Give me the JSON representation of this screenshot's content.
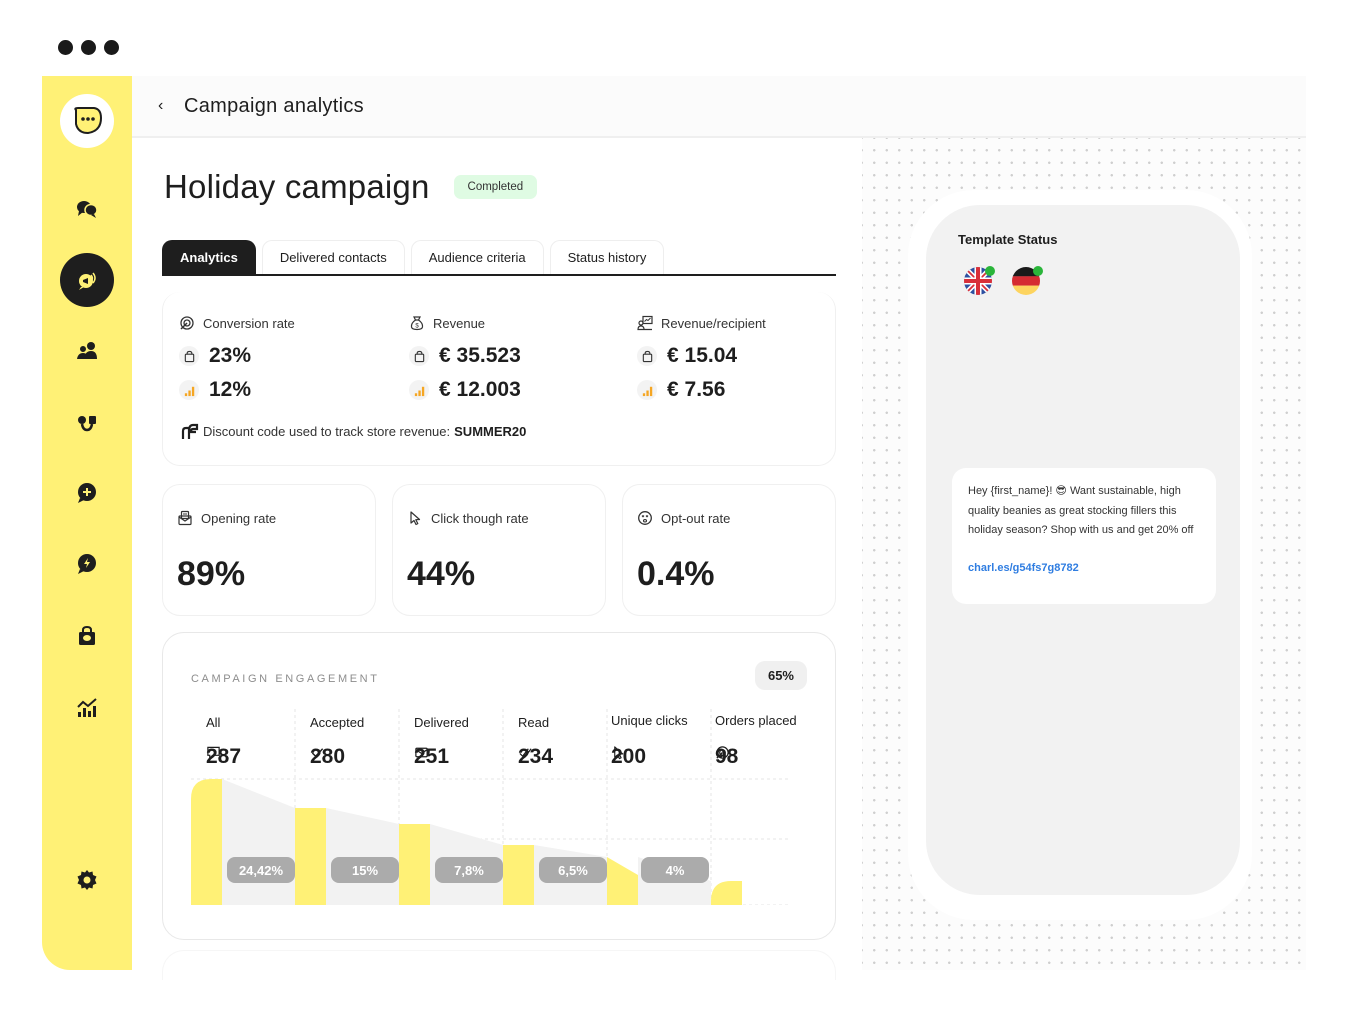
{
  "window": {
    "controls": [
      "dot",
      "dot",
      "dot"
    ]
  },
  "sidebar": {
    "logo": "chat-bubble-logo",
    "items": [
      {
        "name": "conversations",
        "icon": "chat-bubbles-icon",
        "active": false
      },
      {
        "name": "campaigns",
        "icon": "megaphone-icon",
        "active": true
      },
      {
        "name": "contacts",
        "icon": "users-icon",
        "active": false
      },
      {
        "name": "integrations",
        "icon": "plug-icon",
        "active": false
      },
      {
        "name": "new-chat",
        "icon": "chat-plus-icon",
        "active": false
      },
      {
        "name": "automations",
        "icon": "chat-lightning-icon",
        "active": false
      },
      {
        "name": "shop",
        "icon": "shopping-bag-icon",
        "active": false
      },
      {
        "name": "analytics",
        "icon": "chart-icon",
        "active": false
      }
    ],
    "settings_icon": "gear-icon"
  },
  "header": {
    "back_icon": "‹",
    "title": "Campaign analytics"
  },
  "main": {
    "title": "Holiday campaign",
    "status": "Completed",
    "tabs": [
      {
        "label": "Analytics",
        "active": true
      },
      {
        "label": "Delivered contacts",
        "active": false
      },
      {
        "label": "Audience criteria",
        "active": false
      },
      {
        "label": "Status history",
        "active": false
      }
    ],
    "revenue_metrics": [
      {
        "label": "Conversion rate",
        "icon": "target-icon",
        "primary": "23%",
        "secondary": "12%"
      },
      {
        "label": "Revenue",
        "icon": "money-bag-icon",
        "primary": "€ 35.523",
        "secondary": "€ 12.003"
      },
      {
        "label": "Revenue/recipient",
        "icon": "user-chart-icon",
        "primary": "€ 15.04",
        "secondary": "€ 7.56"
      }
    ],
    "discount": {
      "text": "Discount code used to track store revenue:",
      "code": "SUMMER20"
    },
    "rates": [
      {
        "label": "Opening rate",
        "icon": "envelope-open-icon",
        "value": "89%"
      },
      {
        "label": "Click though rate",
        "icon": "cursor-icon",
        "value": "44%"
      },
      {
        "label": "Opt-out rate",
        "icon": "sad-face-icon",
        "value": "0.4%"
      }
    ],
    "engagement": {
      "title": "CAMPAIGN ENGAGEMENT",
      "badge": "65%",
      "stages": [
        {
          "label": "All",
          "icon": "chat-icon",
          "value": "287"
        },
        {
          "label": "Accepted",
          "icon": "check-icon",
          "value": "280"
        },
        {
          "label": "Delivered",
          "icon": "envelope-icon",
          "value": "251"
        },
        {
          "label": "Read",
          "icon": "double-check-icon",
          "value": "234"
        },
        {
          "label": "Unique clicks",
          "icon": "cursor-icon",
          "value": "200"
        },
        {
          "label": "Orders placed",
          "icon": "target-icon",
          "value": "98"
        }
      ],
      "drop_pcts": [
        "24,42%",
        "15%",
        "7,8%",
        "6,5%",
        "4%"
      ],
      "colors": {
        "bar": "#fff176",
        "area": "#f2f2f2",
        "pill": "#ababab"
      }
    }
  },
  "template": {
    "title": "Template Status",
    "languages": [
      {
        "name": "English",
        "flag": "uk-flag-icon",
        "status": "approved"
      },
      {
        "name": "German",
        "flag": "de-flag-icon",
        "status": "approved"
      }
    ],
    "message": "Hey {first_name}! 😎 Want sustainable, high quality beanies as great stocking fillers this holiday season? Shop with us and get 20% off",
    "link": "charl.es/g54fs7g8782"
  },
  "colors": {
    "accent": "#fff176",
    "dark": "#1e1e1e",
    "badge_bg": "#dffbe3",
    "link": "#2f7de1",
    "status_dot": "#2ab53a"
  }
}
